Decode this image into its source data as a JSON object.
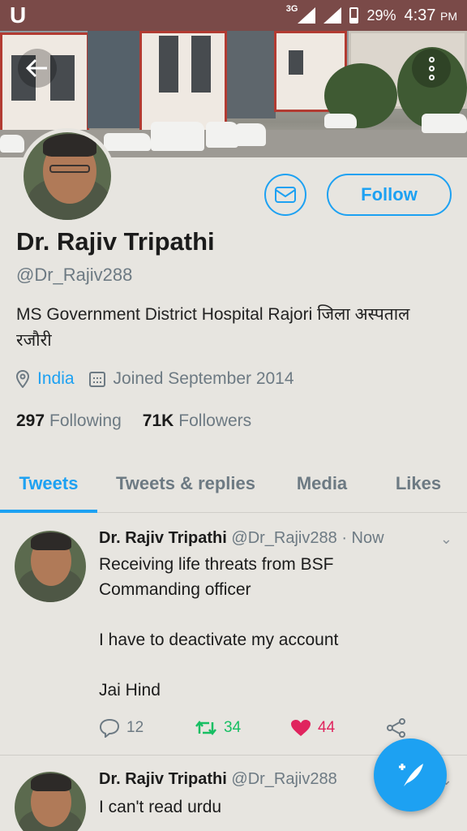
{
  "status_bar": {
    "app_letter": "U",
    "network": "3G",
    "battery": "29%",
    "time": "4:37",
    "ampm": "PM"
  },
  "profile": {
    "name": "Dr. Rajiv Tripathi",
    "handle": "@Dr_Rajiv288",
    "bio": "MS Government District Hospital Rajori जिला अस्पताल रजौरी",
    "location": "India",
    "joined": "Joined September 2014",
    "following_count": "297",
    "following_label": "Following",
    "followers_count": "71K",
    "followers_label": "Followers",
    "follow_label": "Follow"
  },
  "tabs": [
    {
      "label": "Tweets"
    },
    {
      "label": "Tweets & replies"
    },
    {
      "label": "Media"
    },
    {
      "label": "Likes"
    }
  ],
  "tweets": [
    {
      "author": "Dr. Rajiv Tripathi",
      "handle": "@Dr_Rajiv288",
      "time": "· Now",
      "line1": "Receiving life threats from BSF",
      "line2": "Commanding officer",
      "line3": "I have to deactivate my account",
      "line4": "Jai Hind",
      "replies": "12",
      "retweets": "34",
      "likes": "44"
    },
    {
      "author": "Dr. Rajiv Tripathi",
      "handle": "@Dr_Rajiv288",
      "line1": "I can't read urdu"
    }
  ],
  "colors": {
    "accent": "#1da1f2",
    "retweet": "#17bf63",
    "like": "#e0245e",
    "status_bar": "#7a4a48"
  },
  "icons": [
    "back-arrow-icon",
    "more-vertical-icon",
    "mail-icon",
    "location-pin-icon",
    "calendar-icon",
    "reply-icon",
    "retweet-icon",
    "heart-icon",
    "share-icon",
    "compose-icon",
    "chevron-down-icon"
  ]
}
